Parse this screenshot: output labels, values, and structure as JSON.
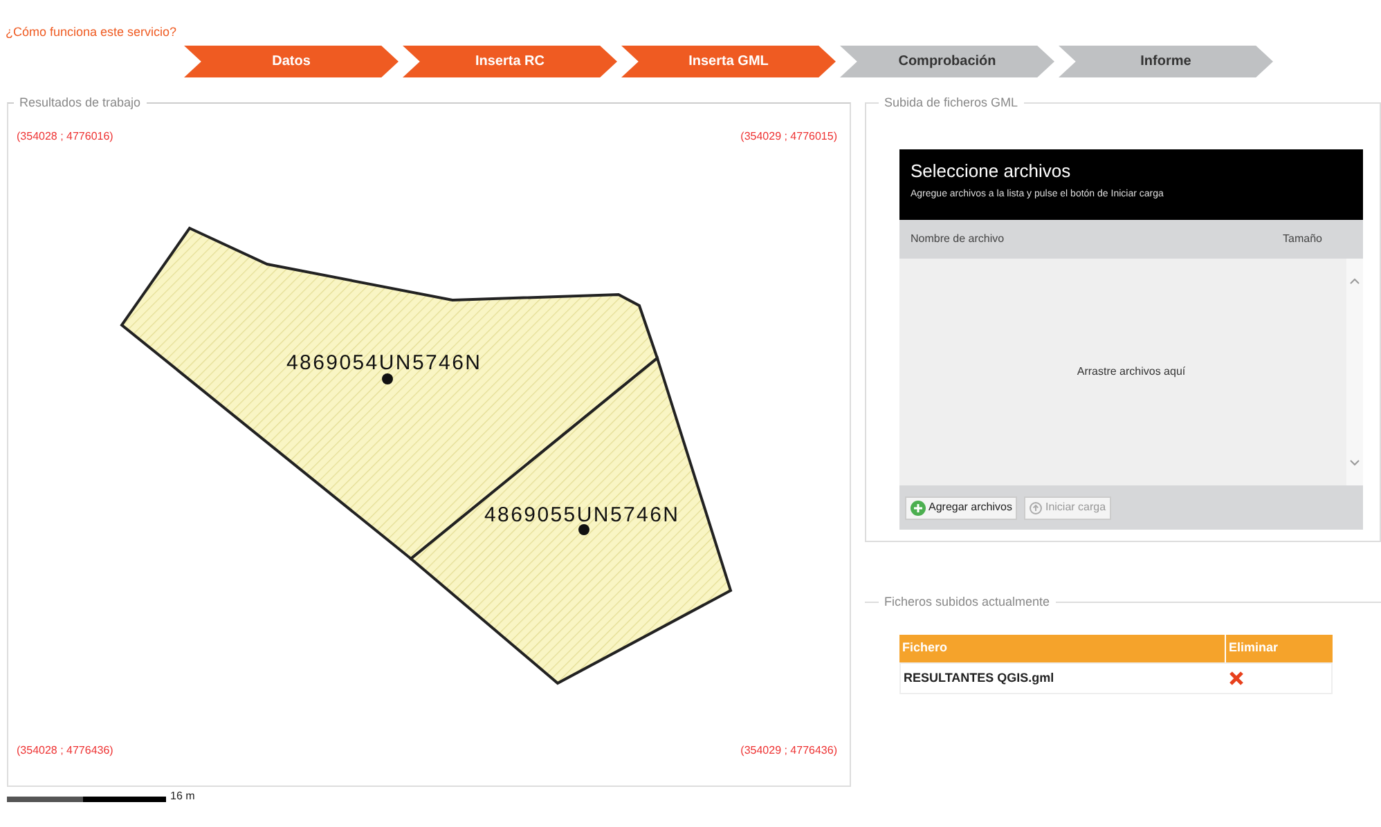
{
  "help_link": "¿Cómo funciona este servicio?",
  "steps": [
    {
      "label": "Datos",
      "done": true
    },
    {
      "label": "Inserta RC",
      "done": true
    },
    {
      "label": "Inserta GML",
      "done": true
    },
    {
      "label": "Comprobación",
      "done": false
    },
    {
      "label": "Informe",
      "done": false
    }
  ],
  "map_panel": {
    "title": "Resultados de trabajo",
    "corners": [
      "(354028 ; 4776016)",
      "(354029 ; 4776015)",
      "(354028 ; 4776436)",
      "(354029 ; 4776436)"
    ],
    "parcels": [
      {
        "label": "4869054UN5746N"
      },
      {
        "label": "4869055UN5746N"
      }
    ],
    "scale_label": "16 m"
  },
  "upload_panel": {
    "title": "Subida de ficheros GML",
    "header_title": "Seleccione archivos",
    "header_subtitle": "Agregue archivos a la lista y pulse el botón de Iniciar carga",
    "columns": [
      "Nombre de archivo",
      "Tamaño"
    ],
    "drop_hint": "Arrastre archivos aquí",
    "buttons": [
      {
        "label": "Agregar archivos",
        "kind": "add",
        "disabled": false
      },
      {
        "label": "Iniciar carga",
        "kind": "start",
        "disabled": true
      }
    ]
  },
  "uploaded_panel": {
    "title": "Ficheros subidos actualmente",
    "columns": [
      "Fichero",
      "Eliminar"
    ],
    "rows": [
      {
        "file": "RESULTANTES QGIS.gml"
      }
    ]
  }
}
